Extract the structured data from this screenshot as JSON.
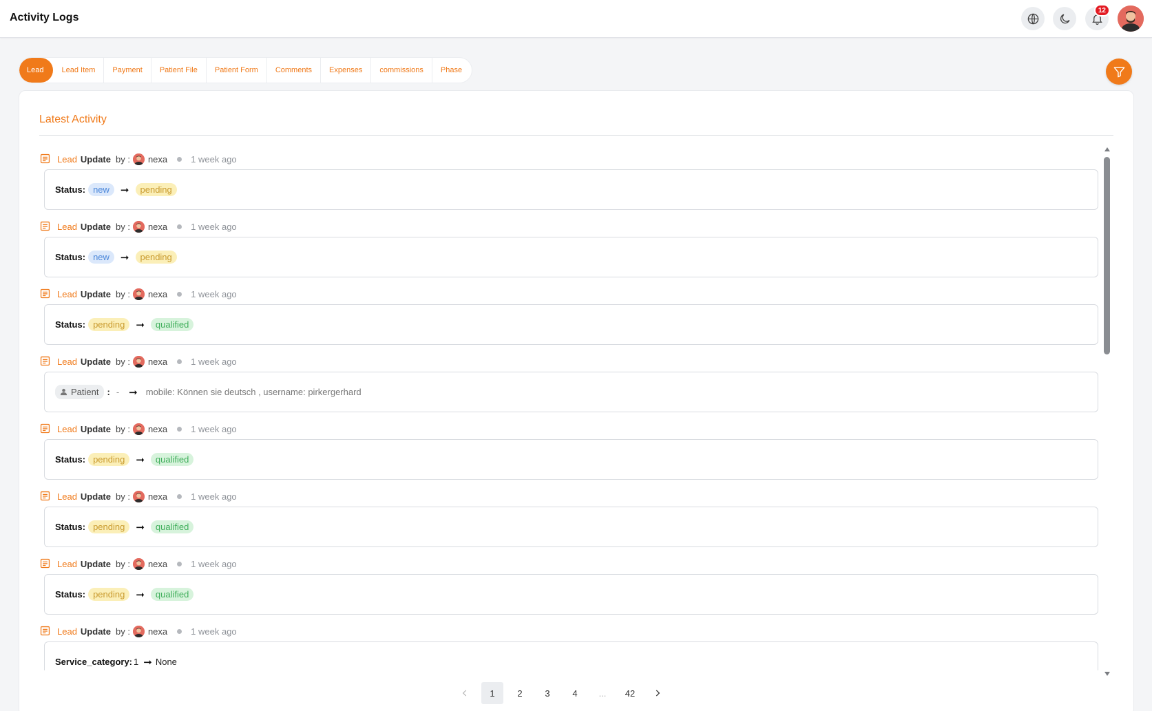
{
  "header": {
    "title": "Activity Logs",
    "notification_count": "12"
  },
  "tabs": [
    {
      "label": "Lead",
      "active": true
    },
    {
      "label": "Lead Item",
      "active": false
    },
    {
      "label": "Payment",
      "active": false
    },
    {
      "label": "Patient File",
      "active": false
    },
    {
      "label": "Patient Form",
      "active": false
    },
    {
      "label": "Comments",
      "active": false
    },
    {
      "label": "Expenses",
      "active": false
    },
    {
      "label": "commissions",
      "active": false
    },
    {
      "label": "Phase",
      "active": false
    }
  ],
  "card": {
    "title": "Latest Activity"
  },
  "log_common": {
    "entity": "Lead",
    "action": "Update",
    "by_label": "by :",
    "user": "nexa",
    "time": "1 week ago"
  },
  "logs": [
    {
      "type": "status",
      "label": "Status:",
      "from": "new",
      "to": "pending"
    },
    {
      "type": "status",
      "label": "Status:",
      "from": "new",
      "to": "pending"
    },
    {
      "type": "status",
      "label": "Status:",
      "from": "pending",
      "to": "qualified"
    },
    {
      "type": "patient",
      "label": "Patient",
      "sep": ":",
      "from": "-",
      "to": "mobile: Können sie deutsch , username: pirkergerhard"
    },
    {
      "type": "status",
      "label": "Status:",
      "from": "pending",
      "to": "qualified"
    },
    {
      "type": "status",
      "label": "Status:",
      "from": "pending",
      "to": "qualified"
    },
    {
      "type": "status",
      "label": "Status:",
      "from": "pending",
      "to": "qualified"
    },
    {
      "type": "field",
      "label": "Service_category:",
      "from": "1",
      "to": "None"
    }
  ],
  "pagination": {
    "pages": [
      "1",
      "2",
      "3",
      "4",
      "...",
      "42"
    ],
    "current": "1"
  },
  "colors": {
    "accent": "#f07a1a",
    "chip_new": "#dbe8fb",
    "chip_pending": "#fbefb8",
    "chip_qualified": "#d7f3dc",
    "badge": "#e31b23"
  },
  "icons": {
    "language": "globe-icon",
    "theme": "moon-icon",
    "notifications": "bell-icon",
    "filter": "filter-icon",
    "log": "document-icon",
    "patient": "person-icon"
  }
}
